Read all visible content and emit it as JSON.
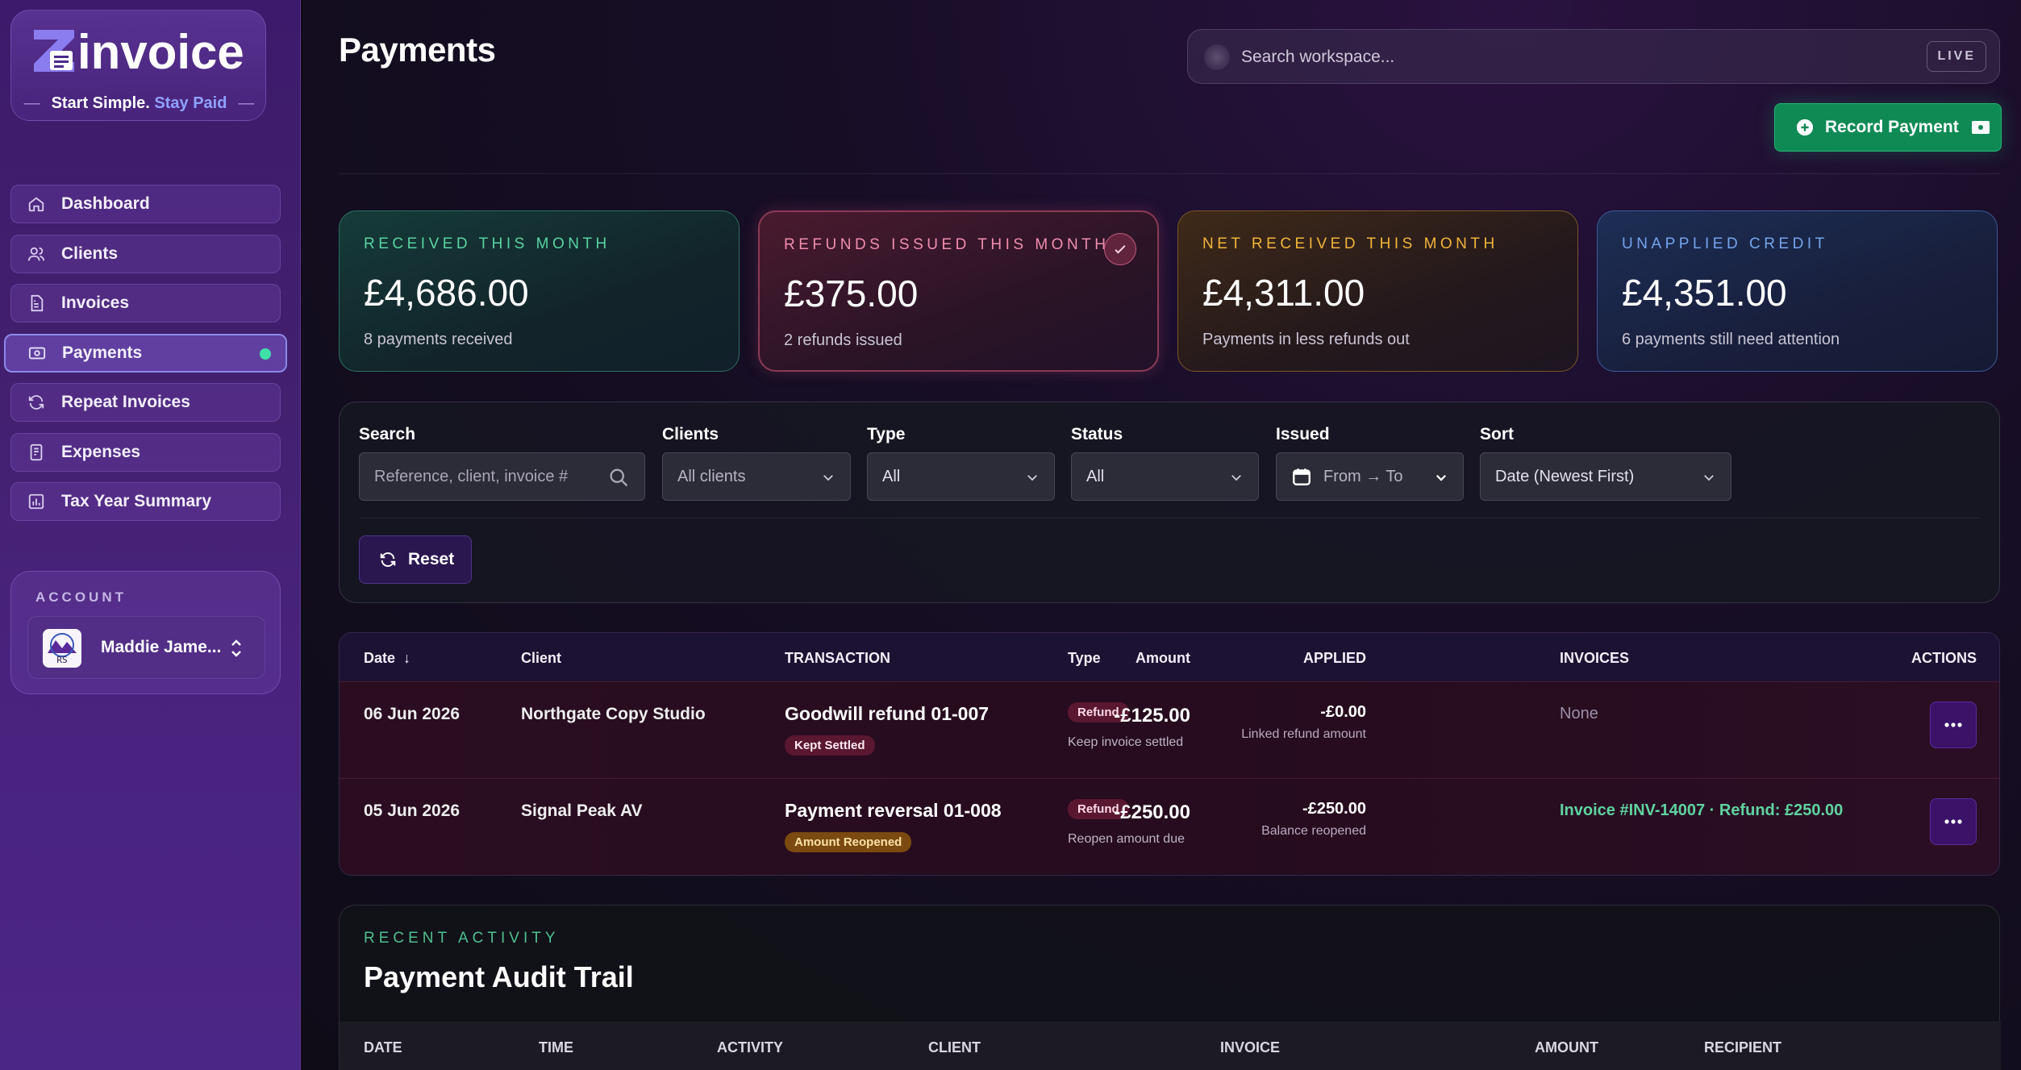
{
  "brand": {
    "name": "invoice",
    "tagline_main": "Start Simple.",
    "tagline_accent": "Stay Paid",
    "accent_color": "#8fa2ff"
  },
  "sidebar": {
    "items": [
      {
        "label": "Dashboard",
        "icon": "home-icon"
      },
      {
        "label": "Clients",
        "icon": "users-icon"
      },
      {
        "label": "Invoices",
        "icon": "document-icon"
      },
      {
        "label": "Payments",
        "icon": "cash-icon",
        "active": true
      },
      {
        "label": "Repeat Invoices",
        "icon": "repeat-icon"
      },
      {
        "label": "Expenses",
        "icon": "receipt-icon"
      },
      {
        "label": "Tax Year Summary",
        "icon": "chart-icon"
      }
    ],
    "account": {
      "label": "ACCOUNT",
      "name": "Maddie Jame...",
      "avatar_text": "RS"
    }
  },
  "header": {
    "title": "Payments",
    "search_placeholder": "Search workspace...",
    "live_badge": "LIVE",
    "record_button": "Record Payment"
  },
  "stats": [
    {
      "label": "RECEIVED THIS MONTH",
      "value": "£4,686.00",
      "sub": "8 payments received",
      "color": "#58d3a0"
    },
    {
      "label": "REFUNDS ISSUED THIS MONTH",
      "value": "£375.00",
      "sub": "2 refunds issued",
      "color": "#f08eae"
    },
    {
      "label": "NET RECEIVED THIS MONTH",
      "value": "£4,311.00",
      "sub": "Payments in less refunds out",
      "color": "#f1b43a"
    },
    {
      "label": "UNAPPLIED CREDIT",
      "value": "£4,351.00",
      "sub": "6 payments still need attention",
      "color": "#74a4ec"
    }
  ],
  "filters": {
    "search": {
      "label": "Search",
      "placeholder": "Reference, client, invoice #"
    },
    "clients": {
      "label": "Clients",
      "value": "All clients"
    },
    "type": {
      "label": "Type",
      "value": "All"
    },
    "status": {
      "label": "Status",
      "value": "All"
    },
    "issued": {
      "label": "Issued",
      "value": "From → To"
    },
    "sort": {
      "label": "Sort",
      "value": "Date (Newest First)"
    },
    "reset": "Reset"
  },
  "table": {
    "headers": {
      "date": "Date",
      "date_sort": "↓",
      "client": "Client",
      "transaction": "TRANSACTION",
      "type": "Type",
      "amount": "Amount",
      "applied": "APPLIED",
      "invoices": "INVOICES",
      "actions": "ACTIONS"
    },
    "rows": [
      {
        "date": "06 Jun 2026",
        "client": "Northgate Copy Studio",
        "transaction": "Goodwill refund 01-007",
        "status_tag": "Kept Settled",
        "type_pill": "Refund",
        "type_sub": "Keep invoice settled",
        "amount": "-£125.00",
        "applied": "-£0.00",
        "applied_sub": "Linked refund amount",
        "invoices": "None"
      },
      {
        "date": "05 Jun 2026",
        "client": "Signal Peak AV",
        "transaction": "Payment reversal 01-008",
        "status_tag": "Amount Reopened",
        "type_pill": "Refund",
        "type_sub": "Reopen amount due",
        "amount": "-£250.00",
        "applied": "-£250.00",
        "applied_sub": "Balance reopened",
        "invoices": "Invoice #INV-14007 · Refund: £250.00"
      }
    ]
  },
  "audit": {
    "label": "RECENT ACTIVITY",
    "title": "Payment Audit Trail",
    "headers": [
      "DATE",
      "TIME",
      "ACTIVITY",
      "CLIENT",
      "INVOICE",
      "AMOUNT",
      "RECIPIENT"
    ]
  }
}
